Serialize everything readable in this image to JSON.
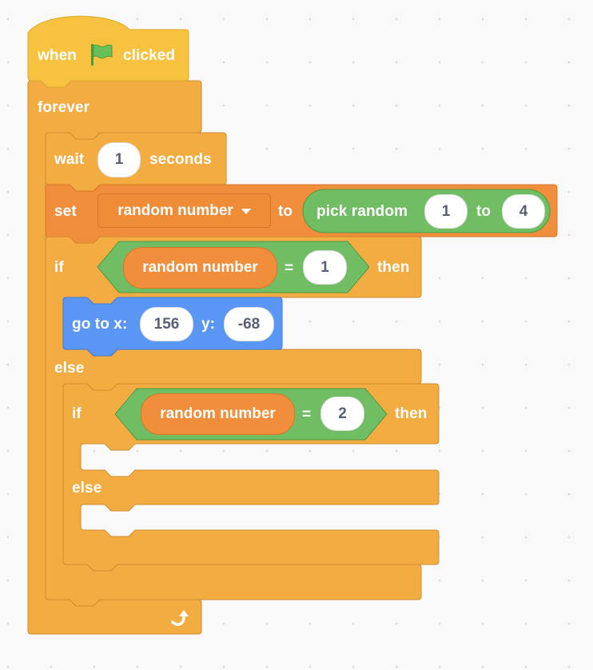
{
  "colors": {
    "events": "#f7c23f",
    "events_border": "#d9a82c",
    "control": "#f3ac42",
    "control_border": "#cf8b2f",
    "variables": "#f08e3b",
    "variables_border": "#d5742a",
    "operators": "#71bd63",
    "operators_border": "#4f9a43",
    "motion": "#5a97f4",
    "motion_border": "#3f77d1",
    "input_text": "#575e75",
    "canvas": "#f9f9f9"
  },
  "script": {
    "hat": {
      "before": "when",
      "icon": "green-flag-icon",
      "after": "clicked"
    },
    "forever": {
      "label": "forever",
      "icon": "loop-arrow-icon"
    },
    "wait": {
      "before": "wait",
      "value": "1",
      "after": "seconds"
    },
    "set": {
      "label": "set",
      "variable": "random number",
      "to": "to",
      "reporter": {
        "label": "pick random",
        "from": "1",
        "to_label": "to",
        "to": "4"
      }
    },
    "if_else_outer": {
      "if": "if",
      "condition": {
        "variable": "random number",
        "operator": "=",
        "value": "1"
      },
      "then": "then",
      "else": "else",
      "goto": {
        "label": "go to x:",
        "x": "156",
        "y_label": "y:",
        "y": "-68"
      }
    },
    "if_else_inner": {
      "if": "if",
      "condition": {
        "variable": "random number",
        "operator": "=",
        "value": "2"
      },
      "then": "then",
      "else": "else"
    }
  }
}
